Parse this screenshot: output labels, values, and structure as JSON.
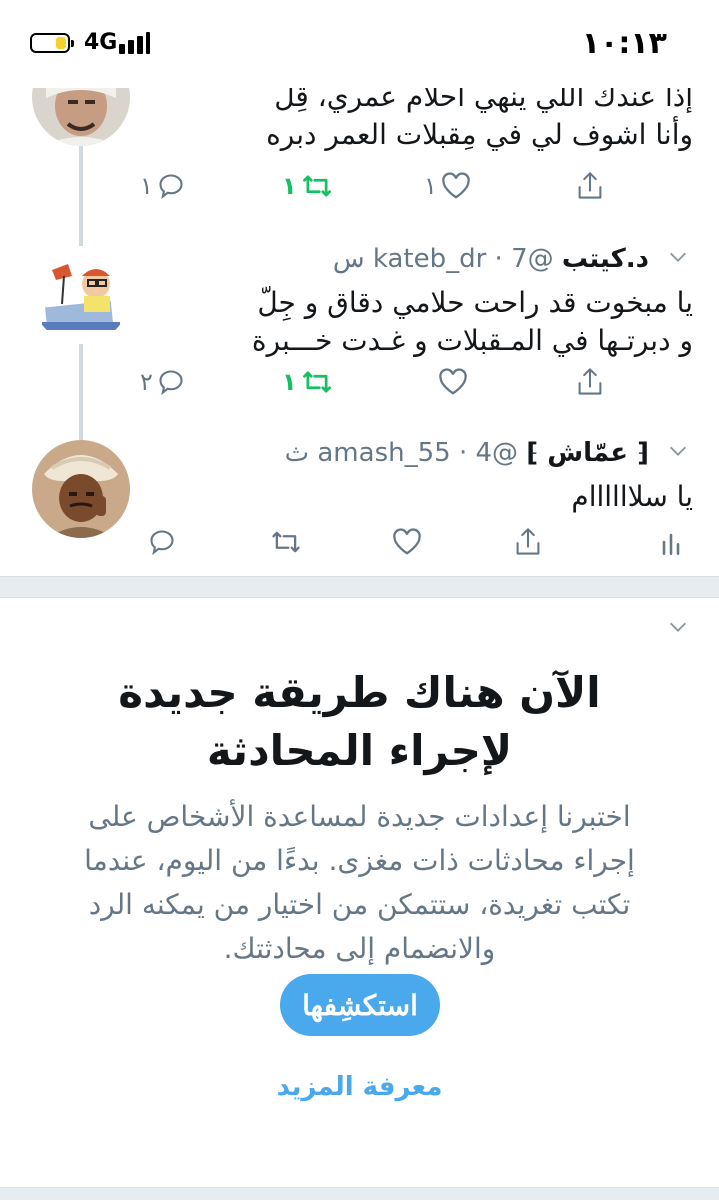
{
  "status_bar": {
    "time": "١٠:١٣",
    "network": "4G",
    "battery_level": 0.3,
    "signal_bars": 4
  },
  "tweets": [
    {
      "name": "",
      "handle": "",
      "time": "",
      "lines": [
        "إذا عندك اللي ينهي آحلام عمري، قِلّ",
        "وأنا اشوف لي في مِقبلات العمر دبره"
      ],
      "replies": "١",
      "retweets": "١",
      "likes": "١",
      "retweeted": true
    },
    {
      "name": "د.كيتب",
      "handle": "@kateb_dr",
      "time": "7 س",
      "lines": [
        "يا مبخوت قد راحت حلامي دقاق و جِلّ",
        "و دبرتـها في المـقبلات و غـدت خـــبرة"
      ],
      "replies": "٢",
      "retweets": "١",
      "likes": "",
      "retweeted": true
    },
    {
      "name": "⁅ عمّاش ⁆",
      "handle": "@amash_55",
      "time": "4 ث",
      "lines": [
        "يا سلاااااام"
      ],
      "replies": "",
      "retweets": "",
      "likes": "",
      "retweeted": false
    }
  ],
  "card": {
    "title": "الآن هناك طريقة جديدة لإجراء المحادثة",
    "description": "اختبرنا إعدادات جديدة لمساعدة الأشخاص على إجراء محادثات ذات مغزى. بدءًا من اليوم، عندما تكتب تغريدة، ستتمكن من اختيار من يمكنه الرد والانضمام إلى محادثتك.",
    "cta_label": "استكشِفها",
    "learn_more_label": "معرفة المزيد"
  },
  "colors": {
    "accent": "#4aa8ec",
    "retweet_green": "#17bf63",
    "secondary_text": "#657786",
    "separator": "#e6ecf0"
  },
  "icons": [
    "reply-icon",
    "retweet-icon",
    "like-icon",
    "share-icon",
    "analytics-icon",
    "chevron-down-icon"
  ]
}
